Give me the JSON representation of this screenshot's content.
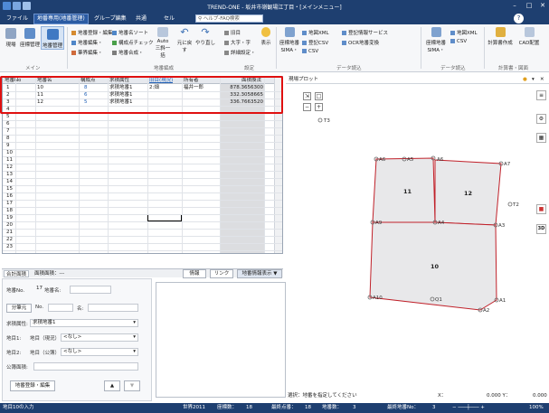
{
  "titlebar": {
    "title": "TREND-ONE - 坂井市嶺観場江丁目・[メインメニュー]",
    "question_icon": "?"
  },
  "menu": [
    "ファイル",
    "地番専用(地番管理)",
    "グループ編集",
    "共通",
    "セル"
  ],
  "help": {
    "placeholder": "ヘルプ-FAQ検索"
  },
  "ribbon": {
    "big1": "現場",
    "big2": "座標管理",
    "big3": "地番管理",
    "g1": [
      "地番登録・編集",
      "地番編集・",
      "筆界編集・"
    ],
    "g2": [
      "地番名ソート",
      "構成点チェック",
      "地番合成・"
    ],
    "g3": "三斜一括",
    "g3b": "Auto",
    "g4": [
      "元に戻す",
      "やり直し"
    ],
    "g5": [
      "旧目",
      "大字・字",
      "詳細設定・"
    ],
    "g6": "表示",
    "g7": [
      "座標地番SIMA・",
      "地図XML",
      "登記CSV",
      "CSV"
    ],
    "g7b": [
      "登記情報サービス",
      "OCR地番変換"
    ],
    "g8": [
      "座標地番SIMA・",
      "地図XML",
      "CSV"
    ],
    "g9": [
      "計算書作成",
      "CAD配置"
    ],
    "labels": [
      "メイン",
      "地番編成",
      "設定",
      "データ読込",
      "データ読込",
      "計算書・図面"
    ]
  },
  "grid": {
    "headers": [
      "地番No",
      "地番名",
      "構成点",
      "求積属性",
      "旧目(現況)",
      "所有者",
      "面積",
      "面積換法"
    ],
    "rows": [
      [
        "1",
        "10",
        "8",
        "求積地番1",
        "2:畑",
        "福井一郎",
        "",
        "878.3656300"
      ],
      [
        "2",
        "11",
        "6",
        "求積地番1",
        "",
        "",
        "",
        "332.3058665"
      ],
      [
        "3",
        "12",
        "5",
        "求積地番1",
        "",
        "",
        "",
        "336.7663520"
      ]
    ],
    "empty_row_numbers": [
      "4",
      "5",
      "6",
      "7",
      "8",
      "9",
      "10",
      "11",
      "12",
      "13",
      "14",
      "15",
      "16",
      "17",
      "18",
      "19",
      "20",
      "21",
      "22",
      "23"
    ]
  },
  "bottom": {
    "tab1": "合計面積",
    "tab2": "面積面積：---",
    "btn_info": "情報",
    "btn_link": "リンク",
    "btn_view": "地番情報表示 ▼"
  },
  "panel": {
    "chiban_no_label": "地番No.",
    "chiban_no": "17",
    "chiban_name_label": "地番名:",
    "bunkatsu": "分筆元",
    "no_label": "No.",
    "name_label": "名:",
    "kyuseki_label": "求積属性:",
    "kyuseki_value": "求積地番1",
    "chimoku1_label": "地目1:",
    "chimoku1_value": "地目（現況）",
    "chimoku1_sel": "<なし>",
    "chimoku2_label": "地目2:",
    "chimoku2_value": "地目（公簿）",
    "chimoku2_sel": "<なし>",
    "kubun_label": "公簿面積:",
    "register_btn": "地番登録・編集",
    "up": "▲",
    "down": "▼"
  },
  "drawing": {
    "header": "現場プロット",
    "points": [
      "T3",
      "A6",
      "A5",
      "A6",
      "A7",
      "A4",
      "A3",
      "A8",
      "A9",
      "T2",
      "A10",
      "Q1",
      "A1",
      "A2"
    ],
    "parcels": [
      "11",
      "12",
      "10"
    ],
    "side_3d": "3D"
  },
  "status_line": {
    "msg": "選択：地番を指定してください",
    "x_label": "X：",
    "x_val": "0.000 Y：",
    "y_val": "0.000"
  },
  "statusbar": {
    "left": "地目10の入力",
    "sekai": "世界2011",
    "zahyo": "座標数：",
    "zahyo_v": "18",
    "saishu": "最終点番：",
    "saishu_v": "18",
    "chiban": "地番数：",
    "chiban_v": "3",
    "saishu_no": "最終地番No：",
    "saishu_no_v": "3",
    "zoom": "100%"
  },
  "colors": {
    "titlebar": "#1e3f70",
    "highlight": "#e01010",
    "parcel_fill": "#e8e8ea",
    "parcel_line": "#c0212a"
  }
}
